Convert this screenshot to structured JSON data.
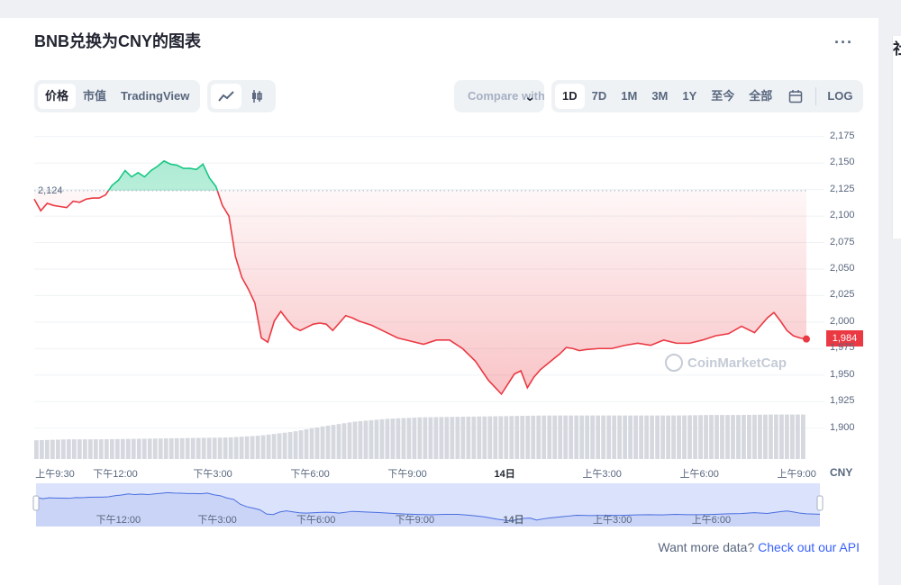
{
  "title": "BNB兑换为CNY的图表",
  "more_icon": "ellipsis-icon",
  "side_title": "社",
  "tabs": [
    {
      "label": "价格",
      "active": true
    },
    {
      "label": "市值",
      "active": false
    },
    {
      "label": "TradingView",
      "active": false
    }
  ],
  "chart_types": [
    {
      "icon": "line-chart-icon",
      "active": true
    },
    {
      "icon": "candlestick-icon",
      "active": false
    }
  ],
  "compare": {
    "label": "Compare with",
    "icon": "chevron-down-icon"
  },
  "ranges": [
    {
      "label": "1D",
      "active": true
    },
    {
      "label": "7D",
      "active": false
    },
    {
      "label": "1M",
      "active": false
    },
    {
      "label": "3M",
      "active": false
    },
    {
      "label": "1Y",
      "active": false
    },
    {
      "label": "至今",
      "active": false
    },
    {
      "label": "全部",
      "active": false
    }
  ],
  "calendar_icon": "calendar-icon",
  "log_label": "LOG",
  "watermark": "CoinMarketCap",
  "api": {
    "text": "Want more data?",
    "link": "Check out our API"
  },
  "colors": {
    "up": "#16c784",
    "down": "#ea3943",
    "volume": "#d5d8de",
    "navigator": "#dbe2fb",
    "navigator_line": "#4a6ee0"
  },
  "chart_data": {
    "type": "line",
    "currency": "CNY",
    "ylim": [
      1875,
      2185
    ],
    "yticks": [
      1900,
      1925,
      1950,
      1975,
      2000,
      2025,
      2050,
      2075,
      2100,
      2125,
      2150,
      2175
    ],
    "reference_price": 2124,
    "current_price": 1984,
    "current_label": "1,984",
    "reference_label": "2,124",
    "xticks": [
      "上午9:30",
      "下午12:00",
      "下午3:00",
      "下午6:00",
      "下午9:00",
      "14日",
      "上午3:00",
      "上午6:00",
      "上午9:00"
    ],
    "xticks_time": [
      0,
      2.5,
      5.5,
      8.5,
      11.5,
      14.5,
      17.5,
      20.5,
      23.5
    ],
    "navigator_ticks": [
      "下午12:00",
      "下午3:00",
      "下午6:00",
      "下午9:00",
      "14日",
      "上午3:00",
      "上午6:00"
    ],
    "navigator_ticks_time": [
      2.5,
      5.5,
      8.5,
      11.5,
      14.5,
      17.5,
      20.5
    ],
    "x_span_hours": [
      0,
      23.8
    ],
    "series": [
      {
        "x": [
          0,
          0.2,
          0.4,
          0.6,
          0.8,
          1.0,
          1.2,
          1.4,
          1.6,
          1.8,
          2.0,
          2.2,
          2.4,
          2.6,
          2.8,
          3.0,
          3.2,
          3.4,
          3.6,
          3.8,
          4.0,
          4.2,
          4.4,
          4.6,
          4.8,
          5.0,
          5.2,
          5.4,
          5.6,
          5.8,
          6.0,
          6.2,
          6.4,
          6.6,
          6.8,
          7.0,
          7.2,
          7.4,
          7.6,
          7.8,
          8.0,
          8.2,
          8.4,
          8.6,
          8.8,
          9.0,
          9.2,
          9.4,
          9.6,
          9.8,
          10.0,
          10.4,
          10.8,
          11.2,
          11.6,
          12.0,
          12.4,
          12.8,
          13.2,
          13.6,
          14.0,
          14.4,
          14.8,
          15.0,
          15.2,
          15.4,
          15.6,
          15.8,
          16.0,
          16.2,
          16.4,
          16.6,
          16.8,
          17.0,
          17.4,
          17.8,
          18.2,
          18.6,
          19.0,
          19.4,
          19.8,
          20.2,
          20.6,
          21.0,
          21.4,
          21.8,
          22.2,
          22.6,
          22.8,
          23.0,
          23.2,
          23.4,
          23.6,
          23.8
        ],
        "values": [
          2116,
          2105,
          2112,
          2110,
          2109,
          2108,
          2114,
          2113,
          2116,
          2117,
          2117,
          2120,
          2129,
          2134,
          2143,
          2137,
          2141,
          2137,
          2143,
          2147,
          2152,
          2149,
          2148,
          2145,
          2145,
          2144,
          2149,
          2136,
          2128,
          2110,
          2100,
          2062,
          2042,
          2031,
          2018,
          1985,
          1981,
          2001,
          2010,
          2002,
          1995,
          1992,
          1995,
          1998,
          1999,
          1998,
          1992,
          1999,
          2006,
          2004,
          2001,
          1997,
          1991,
          1985,
          1982,
          1979,
          1983,
          1983,
          1975,
          1963,
          1945,
          1932,
          1951,
          1954,
          1938,
          1948,
          1955,
          1960,
          1965,
          1970,
          1976,
          1975,
          1973,
          1974,
          1975,
          1975,
          1978,
          1980,
          1978,
          1983,
          1980,
          1980,
          1983,
          1987,
          1989,
          1996,
          1990,
          2004,
          2009,
          2001,
          1992,
          1987,
          1985,
          1984
        ]
      }
    ],
    "volume_level": [
      0.4,
      0.42,
      0.42,
      0.43,
      0.44,
      0.45,
      0.46,
      0.5,
      0.58,
      0.7,
      0.8,
      0.86,
      0.89,
      0.9,
      0.91,
      0.92,
      0.93,
      0.93,
      0.93,
      0.93,
      0.93,
      0.94,
      0.94,
      0.95,
      0.95
    ]
  }
}
